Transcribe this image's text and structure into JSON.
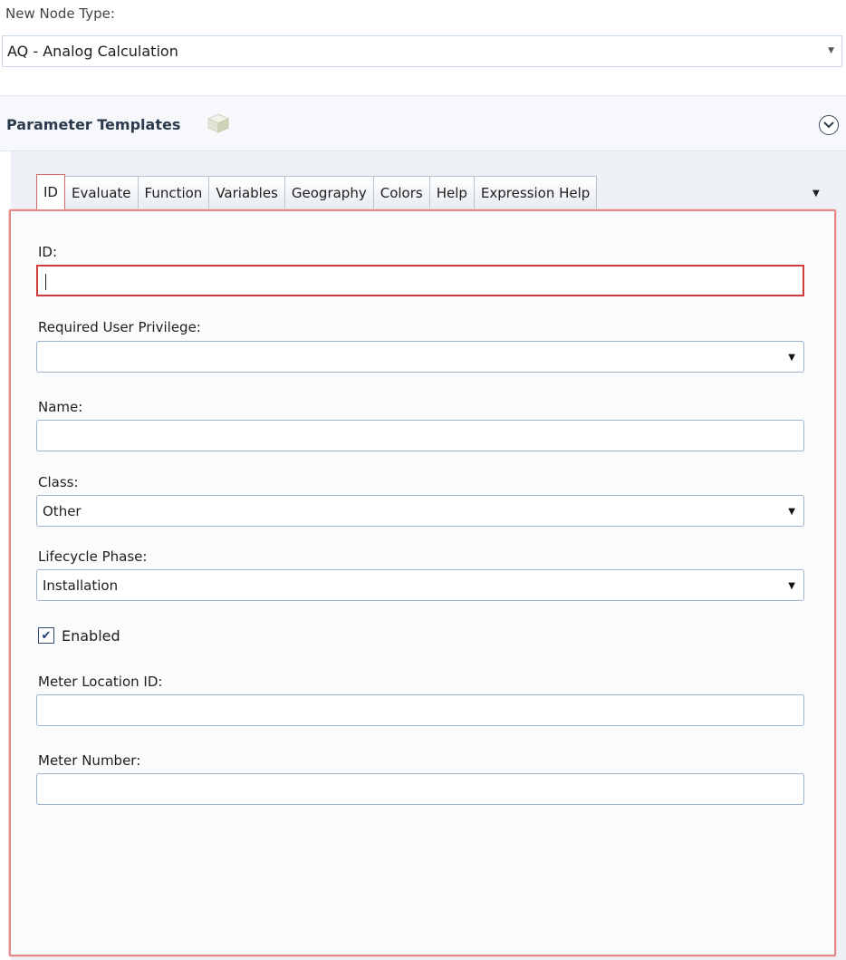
{
  "top": {
    "label": "New Node Type:",
    "node_type_value": "AQ - Analog Calculation"
  },
  "section": {
    "title": "Parameter Templates"
  },
  "tabs": [
    {
      "label": "ID",
      "active": true
    },
    {
      "label": "Evaluate",
      "active": false
    },
    {
      "label": "Function",
      "active": false
    },
    {
      "label": "Variables",
      "active": false
    },
    {
      "label": "Geography",
      "active": false
    },
    {
      "label": "Colors",
      "active": false
    },
    {
      "label": "Help",
      "active": false
    },
    {
      "label": "Expression Help",
      "active": false
    }
  ],
  "form": {
    "id_label": "ID:",
    "id_value": "",
    "privilege_label": "Required User Privilege:",
    "privilege_value": "",
    "name_label": "Name:",
    "name_value": "",
    "class_label": "Class:",
    "class_value": "Other",
    "lifecycle_label": "Lifecycle Phase:",
    "lifecycle_value": "Installation",
    "enabled_label": "Enabled",
    "enabled_checked": true,
    "meter_location_label": "Meter Location ID:",
    "meter_location_value": "",
    "meter_number_label": "Meter Number:",
    "meter_number_value": ""
  },
  "icons": {
    "dropdown": "chevron-down-icon",
    "collapse": "circle-chevron-icon",
    "templates": "cube-icon",
    "check": "checkmark-icon"
  },
  "colors": {
    "error_border": "#cf3b3b",
    "field_border": "#9fb4cc",
    "panel_bg": "#edf1f6"
  }
}
